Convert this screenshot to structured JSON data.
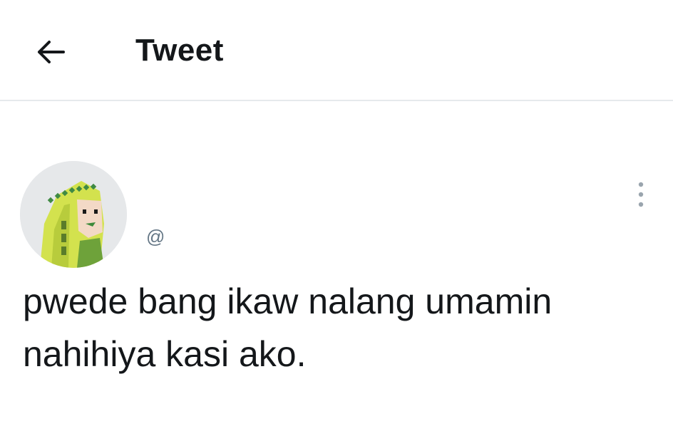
{
  "header": {
    "title": "Tweet",
    "back_icon": "arrow-left-icon"
  },
  "tweet": {
    "avatar_icon": "avatar-illustration",
    "handle": "@",
    "more_icon": "more-vertical-icon",
    "text": "pwede bang ikaw nalang umamin\nnahihiya kasi ako."
  },
  "colors": {
    "text": "#14171a",
    "secondary_text": "#657786",
    "divider": "#e6e9ec",
    "avatar_bg": "#e6e8ea",
    "avatar_yellow": "#cfe04a",
    "avatar_green": "#4c8a3a"
  }
}
